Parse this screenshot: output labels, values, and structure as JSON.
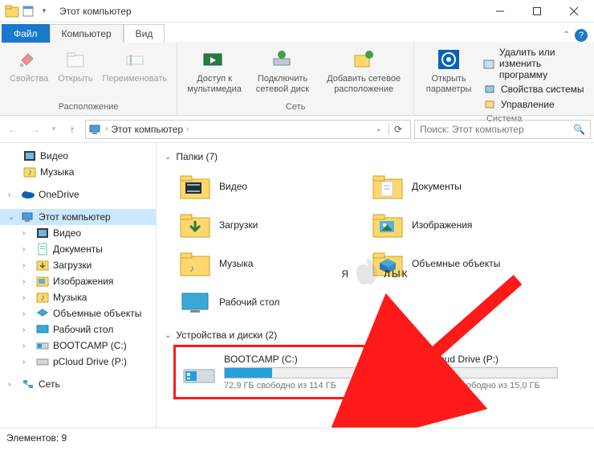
{
  "window": {
    "title": "Этот компьютер"
  },
  "tabs": {
    "file": "Файл",
    "computer": "Компьютер",
    "view": "Вид"
  },
  "ribbon": {
    "group_location": {
      "label": "Расположение",
      "props": "Свойства",
      "open": "Открыть",
      "rename": "Переименовать"
    },
    "group_network": {
      "label": "Сеть",
      "media": "Доступ к мультимедиа",
      "map": "Подключить сетевой диск",
      "add": "Добавить сетевое расположение"
    },
    "group_system": {
      "open_settings": "Открыть параметры",
      "label": "Система",
      "uninstall": "Удалить или изменить программу",
      "sysprops": "Свойства системы",
      "manage": "Управление"
    }
  },
  "breadcrumb": {
    "root": "Этот компьютер",
    "sep": "›"
  },
  "search": {
    "placeholder": "Поиск: Этот компьютер"
  },
  "sidebar": {
    "videos": "Видео",
    "music": "Музыка",
    "onedrive": "OneDrive",
    "thispc": "Этот компьютер",
    "sub_videos": "Видео",
    "sub_docs": "Документы",
    "sub_downloads": "Загрузки",
    "sub_pics": "Изображения",
    "sub_music": "Музыка",
    "sub_3d": "Объемные объекты",
    "sub_desktop": "Рабочий стол",
    "sub_bootcamp": "BOOTCAMP (C:)",
    "sub_pcloud": "pCloud Drive (P:)",
    "network": "Сеть"
  },
  "sections": {
    "folders": "Папки (7)",
    "drives": "Устройства и диски (2)"
  },
  "folders": {
    "videos": "Видео",
    "documents": "Документы",
    "downloads": "Загрузки",
    "pictures": "Изображения",
    "music": "Музыка",
    "objects3d": "Объемные объекты",
    "desktop": "Рабочий стол"
  },
  "drives": {
    "c": {
      "name": "BOOTCAMP (C:)",
      "free": "72,9 ГБ свободно из 114 ГБ",
      "used_pct": 36
    },
    "p": {
      "name": "pCloud Drive (P:)",
      "free": "14,0 ГБ свободно из 15,0 ГБ",
      "used_pct": 7
    }
  },
  "status": {
    "items": "Элементов: 9"
  },
  "watermark": {
    "a": "Я",
    "b": "ЛЫК"
  }
}
